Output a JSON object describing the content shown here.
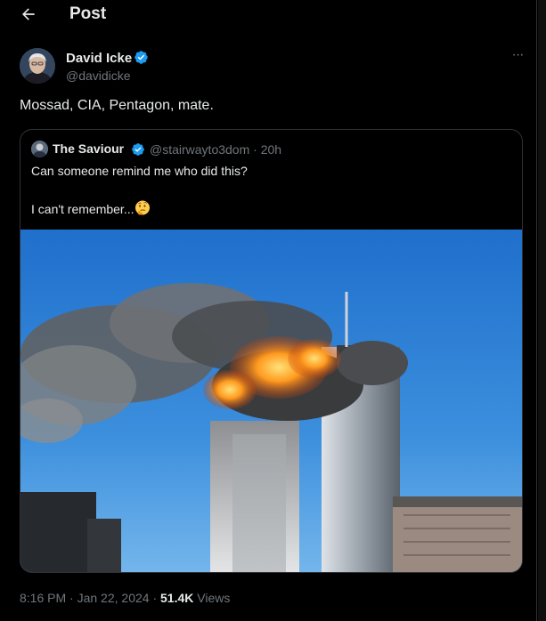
{
  "header": {
    "title": "Post"
  },
  "author": {
    "name": "David Icke",
    "handle": "@davidicke",
    "more_label": "···"
  },
  "tweet": {
    "text": "Mossad, CIA, Pentagon, mate."
  },
  "quote": {
    "name": "The Saviour",
    "handle": "@stairwayto3dom",
    "separator": "·",
    "time": "20h",
    "line1": "Can someone remind me who did this?",
    "line2": "I can't remember...",
    "emoji_icon": "thinking-face-icon",
    "image_description_icon": "photo"
  },
  "footer": {
    "time": "8:16 PM",
    "separator1": "·",
    "date": "Jan 22, 2024",
    "separator2": "·",
    "views_count": "51.4K",
    "views_label": "Views"
  },
  "colors": {
    "background": "#000000",
    "text_primary": "#e7e9ea",
    "text_secondary": "#71767b",
    "border": "#2f3336",
    "verified_blue": "#1d9bf0"
  }
}
